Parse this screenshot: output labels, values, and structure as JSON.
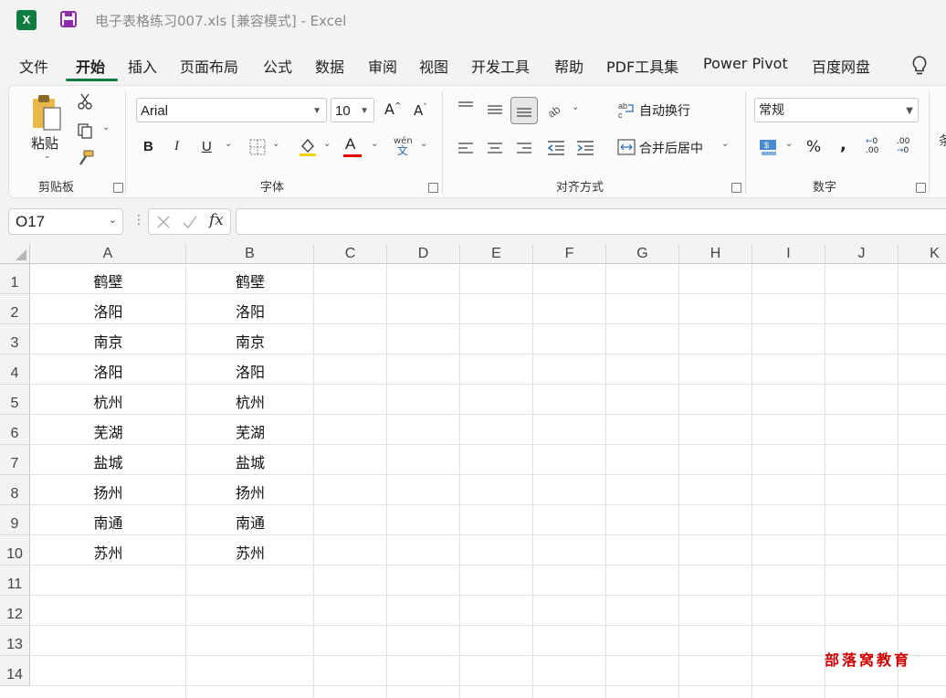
{
  "titlebar": {
    "title": "电子表格练习007.xls  [兼容模式]  -  Excel",
    "app_icon_letter": "X"
  },
  "ribbon_tabs": [
    "文件",
    "开始",
    "插入",
    "页面布局",
    "公式",
    "数据",
    "审阅",
    "视图",
    "开发工具",
    "帮助",
    "PDF工具集",
    "Power Pivot",
    "百度网盘"
  ],
  "active_tab": "开始",
  "ribbon": {
    "clipboard": {
      "paste_label": "粘贴",
      "group_label": "剪贴板"
    },
    "font": {
      "font_name": "Arial",
      "font_size": "10",
      "group_label": "字体",
      "bold": "B",
      "italic": "I",
      "underline": "U"
    },
    "alignment": {
      "wrap_text": "自动换行",
      "merge_center": "合并后居中",
      "group_label": "对齐方式"
    },
    "number": {
      "format": "常规",
      "percent": "%",
      "comma": ",",
      "group_label": "数字"
    }
  },
  "formula_bar": {
    "name_box": "O17",
    "fx": "fx",
    "formula": ""
  },
  "columns": [
    "A",
    "B",
    "C",
    "D",
    "E",
    "F",
    "G",
    "H",
    "I",
    "J",
    "K"
  ],
  "rows": [
    {
      "n": "1",
      "a": "鹤壁",
      "b": "鹤壁"
    },
    {
      "n": "2",
      "a": "洛阳",
      "b": "洛阳"
    },
    {
      "n": "3",
      "a": "南京",
      "b": "南京"
    },
    {
      "n": "4",
      "a": "洛阳",
      "b": "洛阳"
    },
    {
      "n": "5",
      "a": "杭州",
      "b": "杭州"
    },
    {
      "n": "6",
      "a": "芜湖",
      "b": "芜湖"
    },
    {
      "n": "7",
      "a": "盐城",
      "b": "盐城"
    },
    {
      "n": "8",
      "a": "扬州",
      "b": "扬州"
    },
    {
      "n": "9",
      "a": "南通",
      "b": "南通"
    },
    {
      "n": "10",
      "a": "苏州",
      "b": "苏州"
    },
    {
      "n": "11",
      "a": "",
      "b": ""
    },
    {
      "n": "12",
      "a": "",
      "b": ""
    },
    {
      "n": "13",
      "a": "",
      "b": ""
    },
    {
      "n": "14",
      "a": "",
      "b": ""
    }
  ],
  "watermark": "部落窝教育",
  "colors": {
    "accent": "#107c41",
    "watermark": "#d00000"
  }
}
